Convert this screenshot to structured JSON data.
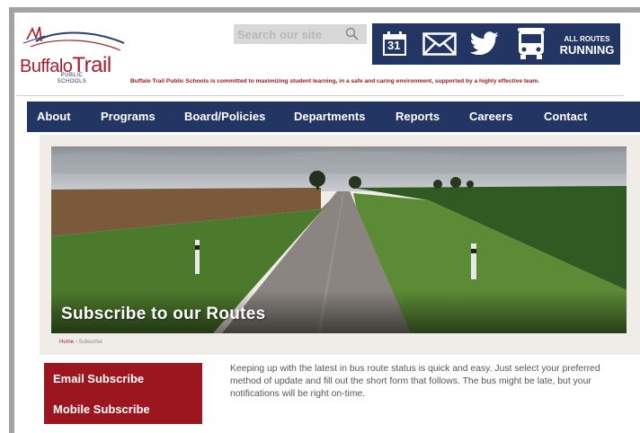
{
  "header": {
    "logo": {
      "name_part1": "Buffalo",
      "name_part2": "Trail",
      "sub_line1": "PUBLIC",
      "sub_line2": "SCHOOLS"
    },
    "search": {
      "placeholder": "Search our site"
    },
    "icons": [
      "calendar-icon",
      "mail-icon",
      "twitter-icon",
      "school-bus-icon"
    ],
    "calendar_day": "31",
    "routes_status": {
      "line1": "ALL ROUTES",
      "line2": "RUNNING"
    },
    "mission": "Buffalo Trail Public Schools is committed to maximizing student learning, in a safe and caring environment, supported by a highly effective team."
  },
  "nav": {
    "items": [
      "About",
      "Programs",
      "Board/Policies",
      "Departments",
      "Reports",
      "Careers",
      "Contact"
    ]
  },
  "hero": {
    "title": "Subscribe to our Routes"
  },
  "breadcrumb": {
    "home": "Home",
    "separator": "›",
    "current": "Subscribe"
  },
  "sidebar": {
    "links": [
      "Email Subscribe",
      "Mobile Subscribe"
    ]
  },
  "main": {
    "description": "Keeping up with the latest in bus route status is quick and easy. Just select your preferred method of update and fill out the short form that follows. The bus might be late, but your notifications will be right on-time."
  },
  "colors": {
    "navy": "#223563",
    "brand_red": "#a71e2a",
    "sidebar_red": "#9c1620",
    "frame_gray": "#a3a3a3"
  }
}
